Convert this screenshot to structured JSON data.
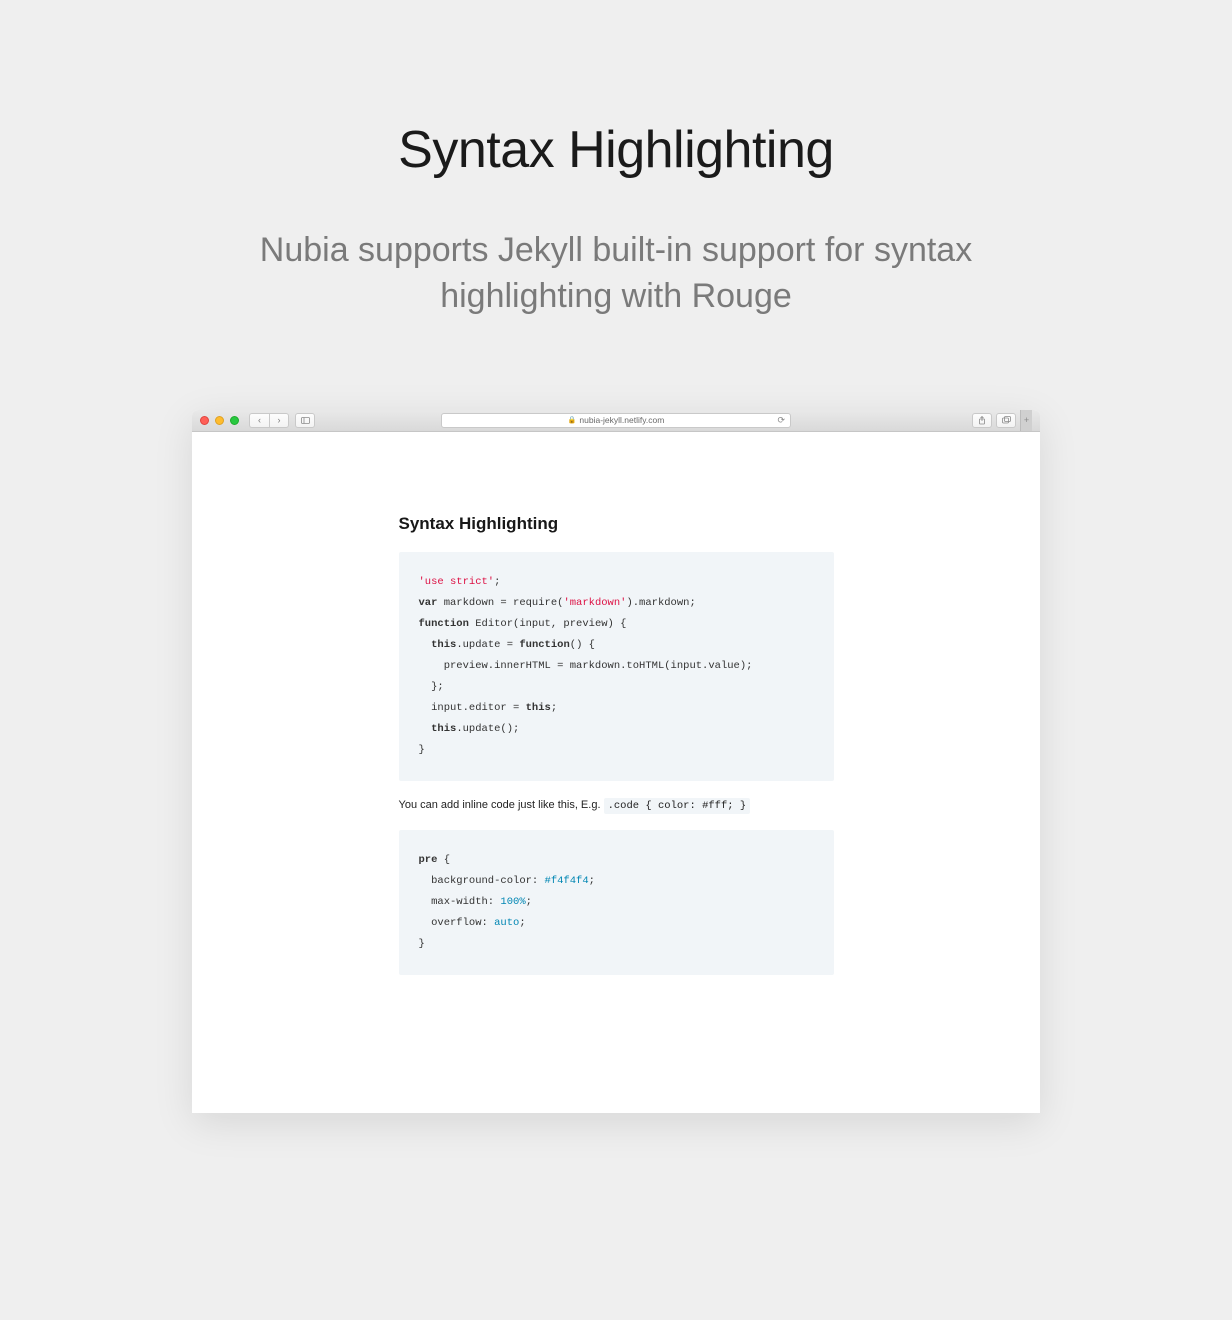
{
  "hero": {
    "title": "Syntax Highlighting",
    "subtitle": "Nubia supports Jekyll built-in support for syntax highlighting with Rouge"
  },
  "browser": {
    "url": "nubia-jekyll.netlify.com"
  },
  "article": {
    "heading": "Syntax Highlighting",
    "js_block": {
      "l1_str": "'use strict'",
      "l1_end": ";",
      "l2_kw": "var",
      "l2_mid": " markdown = require(",
      "l2_str": "'markdown'",
      "l2_end": ").markdown;",
      "l3_kw": "function",
      "l3_end": " Editor(input, preview) {",
      "l4_pre": "  ",
      "l4_kw1": "this",
      "l4_mid": ".update = ",
      "l4_kw2": "function",
      "l4_end": "() {",
      "l5": "    preview.innerHTML = markdown.toHTML(input.value);",
      "l6": "  };",
      "l7_pre": "  input.editor = ",
      "l7_kw": "this",
      "l7_end": ";",
      "l8_pre": "  ",
      "l8_kw": "this",
      "l8_end": ".update();",
      "l9": "}"
    },
    "inline_text": "You can add inline code just like this, E.g. ",
    "inline_code": ".code { color: #fff; }",
    "css_block": {
      "l1_kw": "pre",
      "l1_end": " {",
      "l2_pre": "  background-color: ",
      "l2_val": "#f4f4f4",
      "l2_end": ";",
      "l3_pre": "  max-width: ",
      "l3_val": "100%",
      "l3_end": ";",
      "l4_pre": "  overflow: ",
      "l4_val": "auto",
      "l4_end": ";",
      "l5": "}"
    }
  }
}
